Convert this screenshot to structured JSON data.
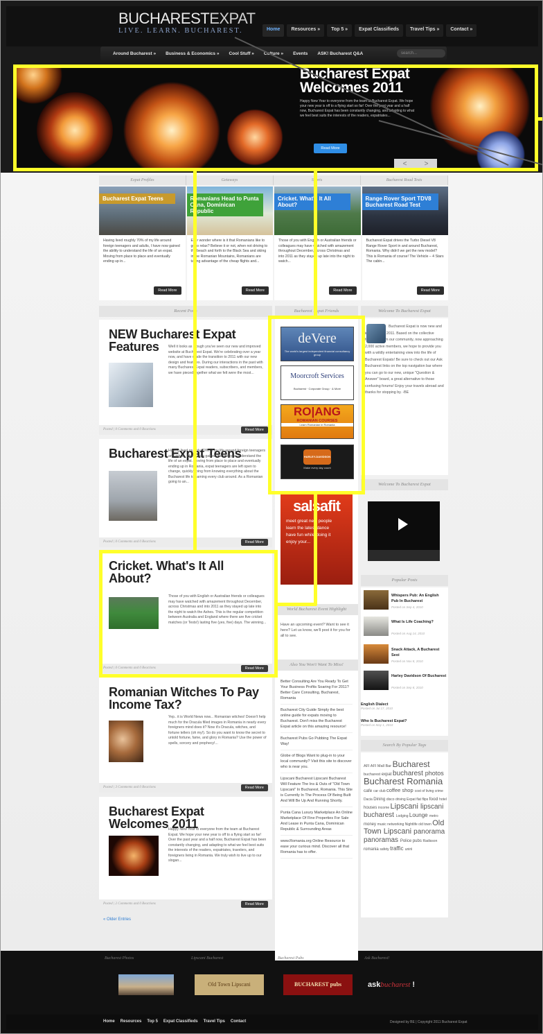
{
  "site": {
    "logo_name_a": "BUCHAREST",
    "logo_name_b": "EXPAT",
    "logo_tagline": "LIVE. LEARN. BUCHAREST."
  },
  "top_nav": [
    "Home",
    "Resources »",
    "Top 5 »",
    "Expat Classifieds",
    "Travel Tips »",
    "Contact »"
  ],
  "sub_nav": [
    "Around Bucharest »",
    "Business & Economics »",
    "Cool Stuff »",
    "Culture »",
    "Events",
    "ASK! Bucharest Q&A"
  ],
  "search_placeholder": "search...",
  "hero": {
    "title_line1": "Bucharest Expat",
    "title_line2": "Welcomes 2011",
    "text": "Happy New Year to everyone from the team at Bucharest Expat. We hope your new year is off to a flying start so far! Over the past year and a half now, Bucharest Expat has been constantly changing, and adapting to what we feel best suits the interests of the readers, expatriates...",
    "button": "Read More",
    "prev": "<",
    "next": ">"
  },
  "featured_tabs": [
    "Expat Profiles",
    "Getaways",
    "Sports",
    "Bucharest Road Tests"
  ],
  "featured_cards": [
    {
      "label": "Bucharest Expat Teens",
      "text": "Having lived roughly 70% of my life around foreign teenagers and adults, I have now gained the ability to understand the life of an expat. Moving from place to place and eventually ending up in...",
      "button": "Read More",
      "color": "#c89a2c"
    },
    {
      "label": "Romanians Head to Punta Cana, Dominican Republic",
      "text": "Ever wonder where is it that Romanians like to go to relax? Believe it or not, when not driving to the beach and forth to the Black Sea and skiing in the Romanian Mountains, Romanians are taking advantage of the cheap flights and...",
      "button": "Read More",
      "color": "#3fa23a"
    },
    {
      "label": "Cricket. What's It All About?",
      "text": "Those of you with English or Australian friends or colleagues may have watched with amazement throughout December, across Christmas and into 2011 as they stayed up late into the night to watch...",
      "button": "Read More",
      "color": "#2e7fd6"
    },
    {
      "label": "Range Rover Sport TDV8 Bucharest Road Test",
      "text": "Bucharest Expat drives the Turbo Diesel V8 Range Rover Sport in and around Bucharest, Romania. Why didn't we get the new model? This is Romania of course! The Vehicle – 4 Stars The cabin...",
      "button": "Read More",
      "color": "#2e7fd6"
    }
  ],
  "column_heads": {
    "recent": "Recent Posts",
    "friends": "Bucharest Expat Friends",
    "welcome": "Welcome To Bucharest Expat",
    "welcome_video": "Welcome To Bucharest Expat",
    "popular": "Popular Posts",
    "event": "World Bucharest Event Highlight",
    "also": "Also You Won't Want To Miss!",
    "tags": "Search By Popular Tags"
  },
  "posts": [
    {
      "title": "NEW Bucharest Expat Features",
      "text": "Well it looks as though you've seen our new and improved website at Bucharest Expat. We're celebrating over a year now, and have made the transition to 2011 with our new design and features. During our interactions in the past with many Bucharest Expat readers, subscribers, and members, we have pieced together what we felt were the most...",
      "meta": "Posted | 0 Comments and 0 Reactions",
      "button": "Read More"
    },
    {
      "title": "Bucharest Expat Teens",
      "text": "Having lived roughly 70% of my life around foreign teenagers and adults, I have now gained the ability to understand the life of an expat. Moving from place to place and eventually ending up in Romania, expat teenagers are left open to change, quickly going from knowing everything about the Bucharest life to naming every club around. As a Romanian going to an...",
      "meta": "Posted | 0 Comments and 0 Reactions",
      "button": "Read More"
    },
    {
      "title": "Cricket. What's It All About?",
      "text": "Those of you with English or Australian friends or colleagues may have watched with amazement throughout December, across Christmas and into 2011 as they stayed up late into the night to watch the Ashes. This is the regular competition between Australia and England where there are five cricket matches (or Tests!) lasting five (yes, five) days. The winning...",
      "meta": "Posted | 0 Comments and 0 Reactions",
      "button": "Read More"
    },
    {
      "title": "Romanian Witches To Pay Income Tax?",
      "text": "Yep.. it is World News now... Romanian witches! Doesn't help much for the Dracula filled images in Romania in nearly every foreigners mind does it? Now it's Dracula, witches, and fortune tellers (oh my!). So do you want to know the secret to untold fortune, fame, and glory in Romania? Use the power of spells, sorcery and prophecy!...",
      "meta": "Posted | 3 Comments and 0 Reactions",
      "button": "Read More"
    },
    {
      "title": "Bucharest Expat Welcomes 2011",
      "text": "Happy New Year to everyone from the team at Bucharest Expat. We hope your new year is off to a flying start so far! Over the past year and a half now, Bucharest Expat has been constantly changing, and adapting to what we feel best suits the interests of the readers, expatriates, travelers, and foreigners living in Romania. We truly wish to live up to our slogan...",
      "meta": "Posted | 2 Comments and 0 Reactions",
      "button": "Read More"
    }
  ],
  "older_entries": "« Older Entries",
  "friends_ads": [
    {
      "name": "deVere",
      "sub": "The world's largest independent financial consultancy group"
    },
    {
      "name": "Moorcroft Services",
      "sub": "Bucharest · Corporate Group · & More"
    },
    {
      "name": "RO|ANG",
      "sub": "ROMANIAN COURSES",
      "sub2": "Learn Romanian in Romania"
    },
    {
      "name": "HARLEY-DAVIDSON",
      "sub": "Make every day count"
    }
  ],
  "salsa_ad": {
    "name": "salsafit",
    "lines": [
      "meet great new people",
      "learn the latest dance",
      "have fun while doing it",
      "enjoy your..."
    ]
  },
  "event_text": "Have an upcoming event? Want to see it here? Let us know, we'll post it for you for all to see.",
  "also_list": [
    "Better Consulting Are You Ready To Get Your Business Profits Soaring For 2011? Better Care Consulting, Bucharest, Romania",
    "Bucharest City Guide Simply the best online guide for expats moving to Bucharest. Don't miss the Bucharest Expat article on this amazing resource!",
    "Bucharest Pubs Go Pubbing The Expat Way!",
    "Globe of Blogs Want to plug-in to your local community? Visit this site to discover who is near you.",
    "Lipscani Bucharest Lipscani Bucharest Will Feature The Ins & Outs of \"Old Town Lipscani\" In Bucharest, Romania. This Site is Currently In The Process Of Being Built And Will Be Up And Running Shortly.",
    "Punta Cana Luxury Marketplace An Online Marketplace Of Fine Properties For Sale And Lease in Punta Cana, Dominican Republic & Surrounding Areas",
    "www.Romania.org Online Resource to ease your curious mind. Discover all that Romania has to offer."
  ],
  "welcome_text": "Bucharest Expat is now new and improved for 2011. Based on the collective feedback from our community, now approaching 2,000 active members, we hope to provide you with a wildly entertaining view into the life of Bucharest Expats! Be sure to check out our Ask Bucharest links on the top navigation bar where you can go to our new, unique \"Question & Answer\" board, a great alternative to those confusing forums! Enjoy your travels abroad and thanks for stopping by. -BE",
  "popular_posts": [
    {
      "title": "Whispers Pub: An English Pub In Bucharest",
      "date": "Posted on Sep 4, 2010"
    },
    {
      "title": "What Is Life Coaching?",
      "date": "Posted on Aug 14, 2010"
    },
    {
      "title": "Snack Attack, A Bucharest Seoi",
      "date": "Posted on Nov 8, 2010"
    },
    {
      "title": "Harley Davidson Of Bucharest",
      "date": "Posted on Sep 8, 2010"
    },
    {
      "title": "English Dialect",
      "date": "Posted on Jul 17, 2010"
    },
    {
      "title": "Who Is Bucharest Expat?",
      "date": "Posted on May 1, 2010"
    }
  ],
  "tag_cloud": [
    {
      "t": "AFI",
      "s": 5.5
    },
    {
      "t": "AFI Mall",
      "s": 5.5
    },
    {
      "t": "Bar",
      "s": 5.5
    },
    {
      "t": "Bucharest",
      "s": 12
    },
    {
      "t": "bucharest",
      "s": 5.5
    },
    {
      "t": "expat",
      "s": 6
    },
    {
      "t": "bucharest",
      "s": 10
    },
    {
      "t": "photos",
      "s": 9
    },
    {
      "t": "Bucharest",
      "s": 13
    },
    {
      "t": "Romania",
      "s": 13
    },
    {
      "t": "cafe",
      "s": 6.5
    },
    {
      "t": "car",
      "s": 5
    },
    {
      "t": "club",
      "s": 5
    },
    {
      "t": "coffee shop",
      "s": 7.5
    },
    {
      "t": "cost of living",
      "s": 5
    },
    {
      "t": "crime",
      "s": 5
    },
    {
      "t": "Dacia",
      "s": 5
    },
    {
      "t": "Dining",
      "s": 6
    },
    {
      "t": "disco",
      "s": 5
    },
    {
      "t": "driving",
      "s": 5
    },
    {
      "t": "Expat",
      "s": 5
    },
    {
      "t": "flat",
      "s": 5
    },
    {
      "t": "flips",
      "s": 5
    },
    {
      "t": "food",
      "s": 6.5
    },
    {
      "t": "hotel",
      "s": 5
    },
    {
      "t": "houses",
      "s": 6
    },
    {
      "t": "income",
      "s": 5
    },
    {
      "t": "Lipscani",
      "s": 11
    },
    {
      "t": "lipscani bucharest",
      "s": 10
    },
    {
      "t": "Lodging",
      "s": 5
    },
    {
      "t": "Lounge",
      "s": 8
    },
    {
      "t": "metro",
      "s": 5
    },
    {
      "t": "money",
      "s": 6
    },
    {
      "t": "music",
      "s": 5
    },
    {
      "t": "networking",
      "s": 5
    },
    {
      "t": "Nightlife",
      "s": 5
    },
    {
      "t": "old town",
      "s": 5
    },
    {
      "t": "Old Town Lipscani",
      "s": 11
    },
    {
      "t": "panorama",
      "s": 10
    },
    {
      "t": "panoramas",
      "s": 10
    },
    {
      "t": "Police",
      "s": 6
    },
    {
      "t": "pubs",
      "s": 6
    },
    {
      "t": "Radisson",
      "s": 5
    },
    {
      "t": "romania",
      "s": 6
    },
    {
      "t": "safety",
      "s": 5
    },
    {
      "t": "traffic",
      "s": 8
    },
    {
      "t": "unirii",
      "s": 5
    }
  ],
  "footer": {
    "heads": [
      "Bucharest Photos",
      "Lipscani Bucharest",
      "Bucharest Pubs",
      "Ask Bucharest!"
    ],
    "logo_lipscani": "Old Town Lipscani",
    "logo_pubs": "BUCHAREST pubs",
    "logo_ask_a": "ask",
    "logo_ask_b": "bucharest",
    "nav": [
      "Home",
      "Resources",
      "Top 5",
      "Expat Classifieds",
      "Travel Tips",
      "Contact"
    ],
    "credit": "Designed by BE | Copyright 2011 Bucharest Expat"
  },
  "colors": {
    "highlight": "#ffff2a",
    "link_blue": "#2f7dd1",
    "button_dark": "#2d2d2d"
  }
}
